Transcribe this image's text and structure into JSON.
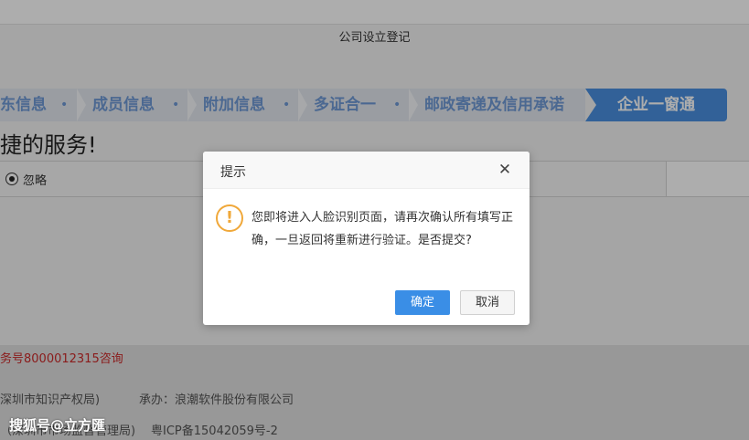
{
  "page": {
    "title": "公司设立登记",
    "subheading": "捷的服务!",
    "steps": [
      {
        "label": "东信息"
      },
      {
        "label": "成员信息"
      },
      {
        "label": "附加信息"
      },
      {
        "label": "多证合一"
      },
      {
        "label": "邮政寄递及信用承诺"
      }
    ],
    "step_separator": "•",
    "active_step": "企业一窗通",
    "option": {
      "label": "忽略"
    },
    "footer": {
      "hotline": "务号8000012315咨询",
      "line1_left": "深圳市知识产权局)",
      "line1_right": "承办：浪潮软件股份有限公司",
      "line2_left": "（深圳市市场监督管理局)",
      "line2_right": "粤ICP备15042059号-2"
    }
  },
  "dialog": {
    "title": "提示",
    "close_symbol": "✕",
    "icon_symbol": "!",
    "message": "您即将进入人脸识别页面，请再次确认所有填写正确，一旦返回将重新进行验证。是否提交?",
    "confirm_label": "确定",
    "cancel_label": "取消"
  },
  "watermark": "搜狐号@立方匯",
  "colors": {
    "accent": "#3a8ee6",
    "step_text": "#6f9ad6",
    "warning": "#f0a83a",
    "hotline": "#cc2a2a"
  },
  "icons": {
    "dialog_close": "close-icon",
    "dialog_warning": "warning-icon"
  }
}
